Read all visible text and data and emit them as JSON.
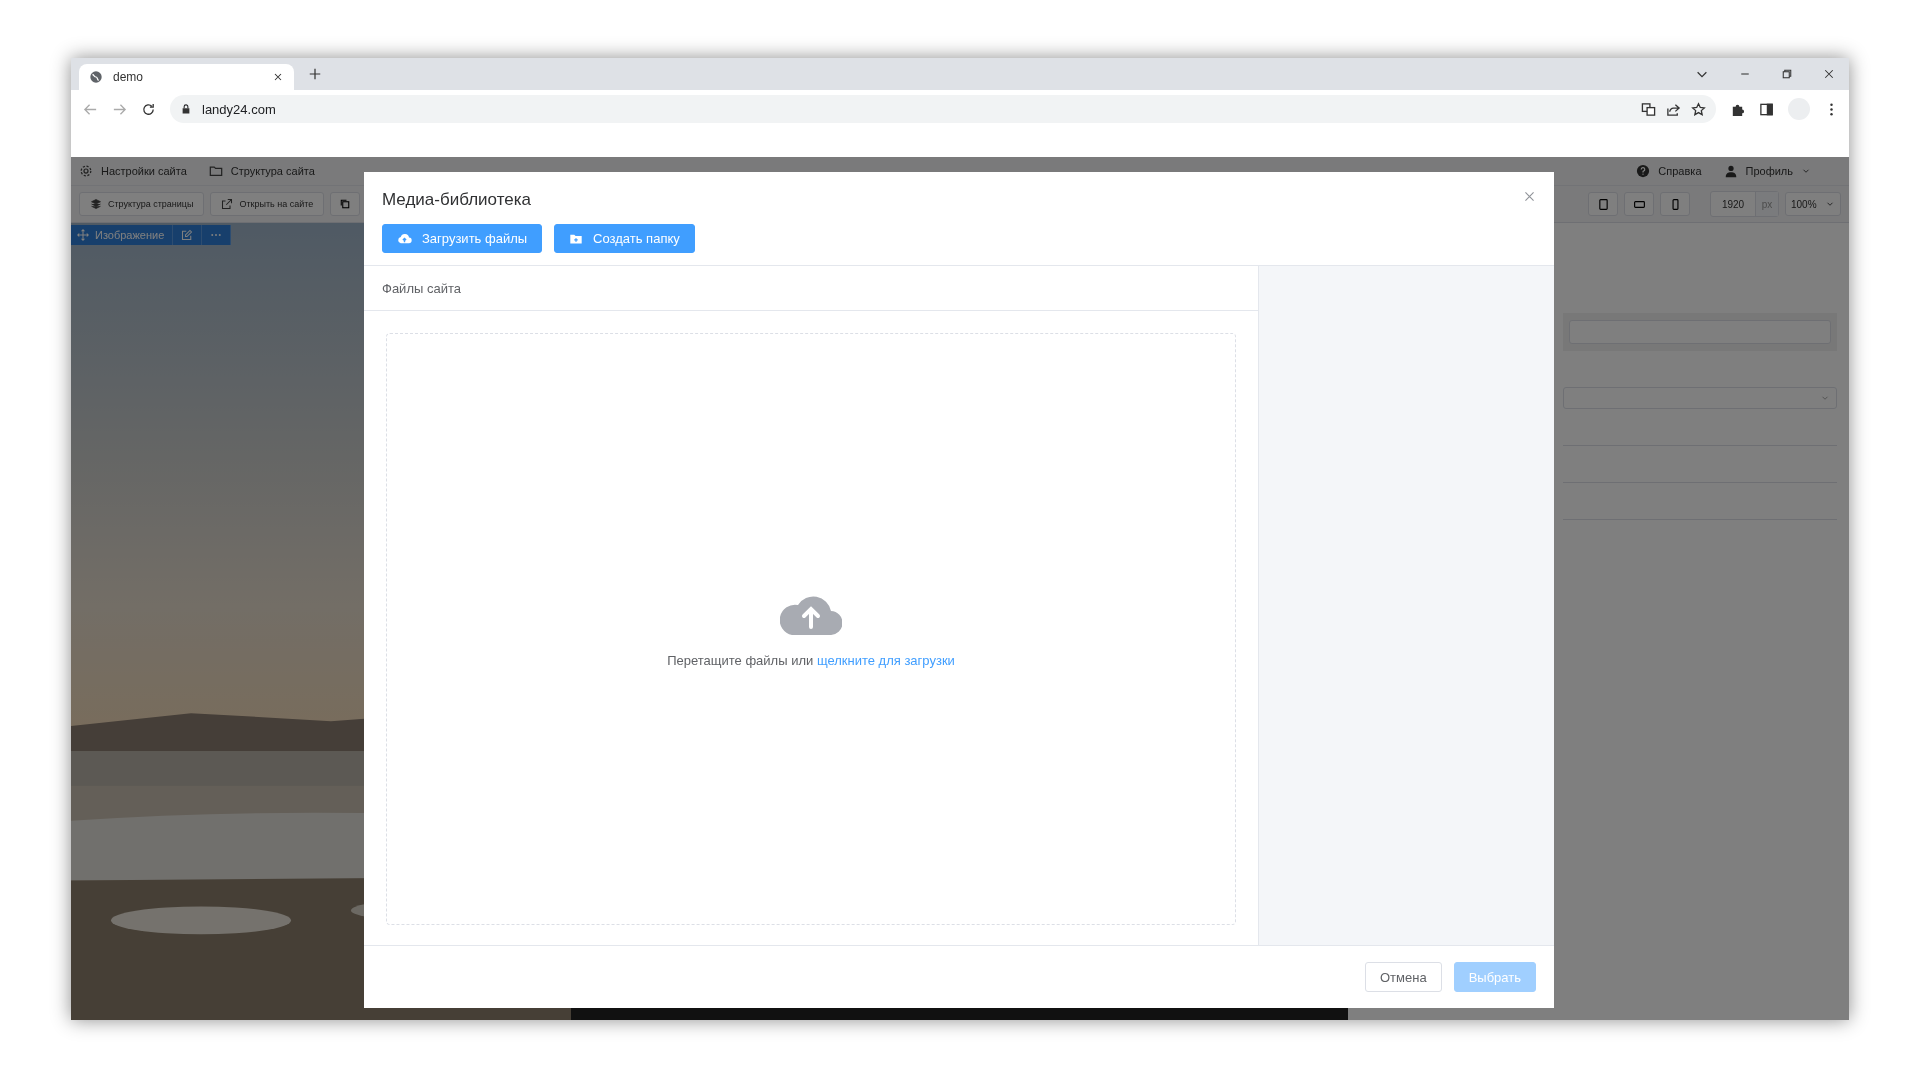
{
  "browser": {
    "tabs": [
      {
        "title": "demo",
        "selected": true
      }
    ],
    "address": "landy24.com"
  },
  "app": {
    "menu": [
      "Настройки сайта",
      "Структура сайта"
    ],
    "right_menu": [
      "Справка",
      "Профиль"
    ],
    "toolbar": [
      "Структура страницы",
      "Открыть на сайте"
    ],
    "width_value": "1920",
    "width_unit": "px",
    "zoom": "100%",
    "element_bar": {
      "label": "Изображение"
    }
  },
  "modal": {
    "title": "Медиа-библиотека",
    "actions": [
      "Загрузить файлы",
      "Создать папку"
    ],
    "section_title": "Файлы сайта",
    "dropzone": {
      "text": "Перетащите файлы или",
      "link": "щелкните для загрузки"
    },
    "buttons": [
      {
        "label": "Отмена",
        "kind": "default",
        "disabled": false
      },
      {
        "label": "Выбрать",
        "kind": "primary",
        "disabled": true
      }
    ]
  }
}
